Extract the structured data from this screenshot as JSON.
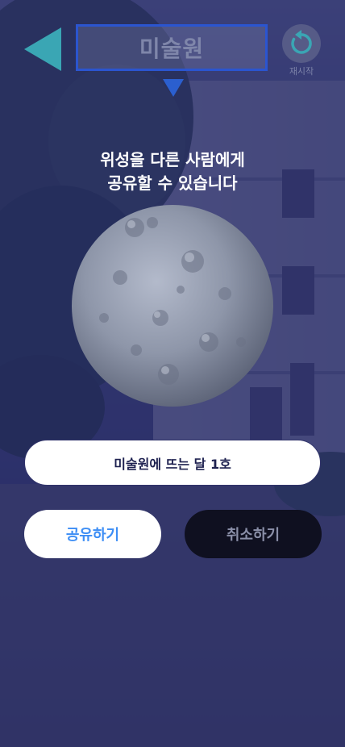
{
  "header": {
    "title": "미술원",
    "restart_label": "재시작"
  },
  "message": {
    "line1": "위성을 다른 사람에게",
    "line2": "공유할 수 있습니다"
  },
  "satellite": {
    "name": "미술원에 뜨는 달 1호"
  },
  "actions": {
    "share_label": "공유하기",
    "cancel_label": "취소하기"
  },
  "icons": {
    "back": "left-triangle-icon",
    "pointer": "down-triangle-icon",
    "restart": "restart-icon"
  },
  "colors": {
    "overlay": "#242866",
    "title_border": "#2b55d0",
    "back_arrow": "#3aa6b4",
    "share_text": "#3d8ef5",
    "cancel_bg": "#0f1020"
  }
}
